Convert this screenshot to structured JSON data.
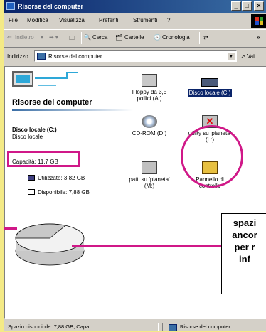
{
  "window": {
    "title": "Risorse del computer",
    "controls": [
      "_",
      "□",
      "×"
    ]
  },
  "menu": [
    "File",
    "Modifica",
    "Visualizza",
    "Preferiti",
    "Strumenti",
    "?"
  ],
  "toolbar": {
    "back": "Indietro",
    "search": "Cerca",
    "folders": "Cartelle",
    "history": "Cronologia"
  },
  "address": {
    "label": "Indirizzo",
    "value": "Risorse del computer",
    "go": "Vai"
  },
  "left_panel": {
    "title": "Risorse del computer",
    "selected_name": "Disco locale (C:)",
    "selected_type": "Disco locale",
    "capacity": "Capacità: 11,7 GB",
    "used": "Utilizzato: 3,82 GB",
    "free": "Disponibile: 7,88 GB"
  },
  "items": [
    {
      "label": "Floppy da 3,5 pollici (A:)",
      "icon": "floppy-drive-icon"
    },
    {
      "label": "Disco locale (C:)",
      "icon": "hard-disk-icon",
      "selected": true
    },
    {
      "label": "CD-ROM (D:)",
      "icon": "cdrom-icon"
    },
    {
      "label": "utility su 'pianeta' (L:)",
      "icon": "network-drive-disconnected-icon"
    },
    {
      "label": "patti su 'pianeta' (M:)",
      "icon": "network-drive-icon"
    },
    {
      "label": "Pannello di controllo",
      "icon": "control-panel-icon"
    }
  ],
  "callout": [
    "spazi",
    "ancor",
    "per r",
    "inf"
  ],
  "status": {
    "left": "Spazio disponibile: 7,88 GB, Capa",
    "right": "Risorse del computer"
  },
  "colors": {
    "highlight": "#d01888",
    "selection": "#0a246a",
    "background": "#f4ea86"
  },
  "disk_usage": {
    "used_gb": 3.82,
    "free_gb": 7.88,
    "total_gb": 11.7
  }
}
